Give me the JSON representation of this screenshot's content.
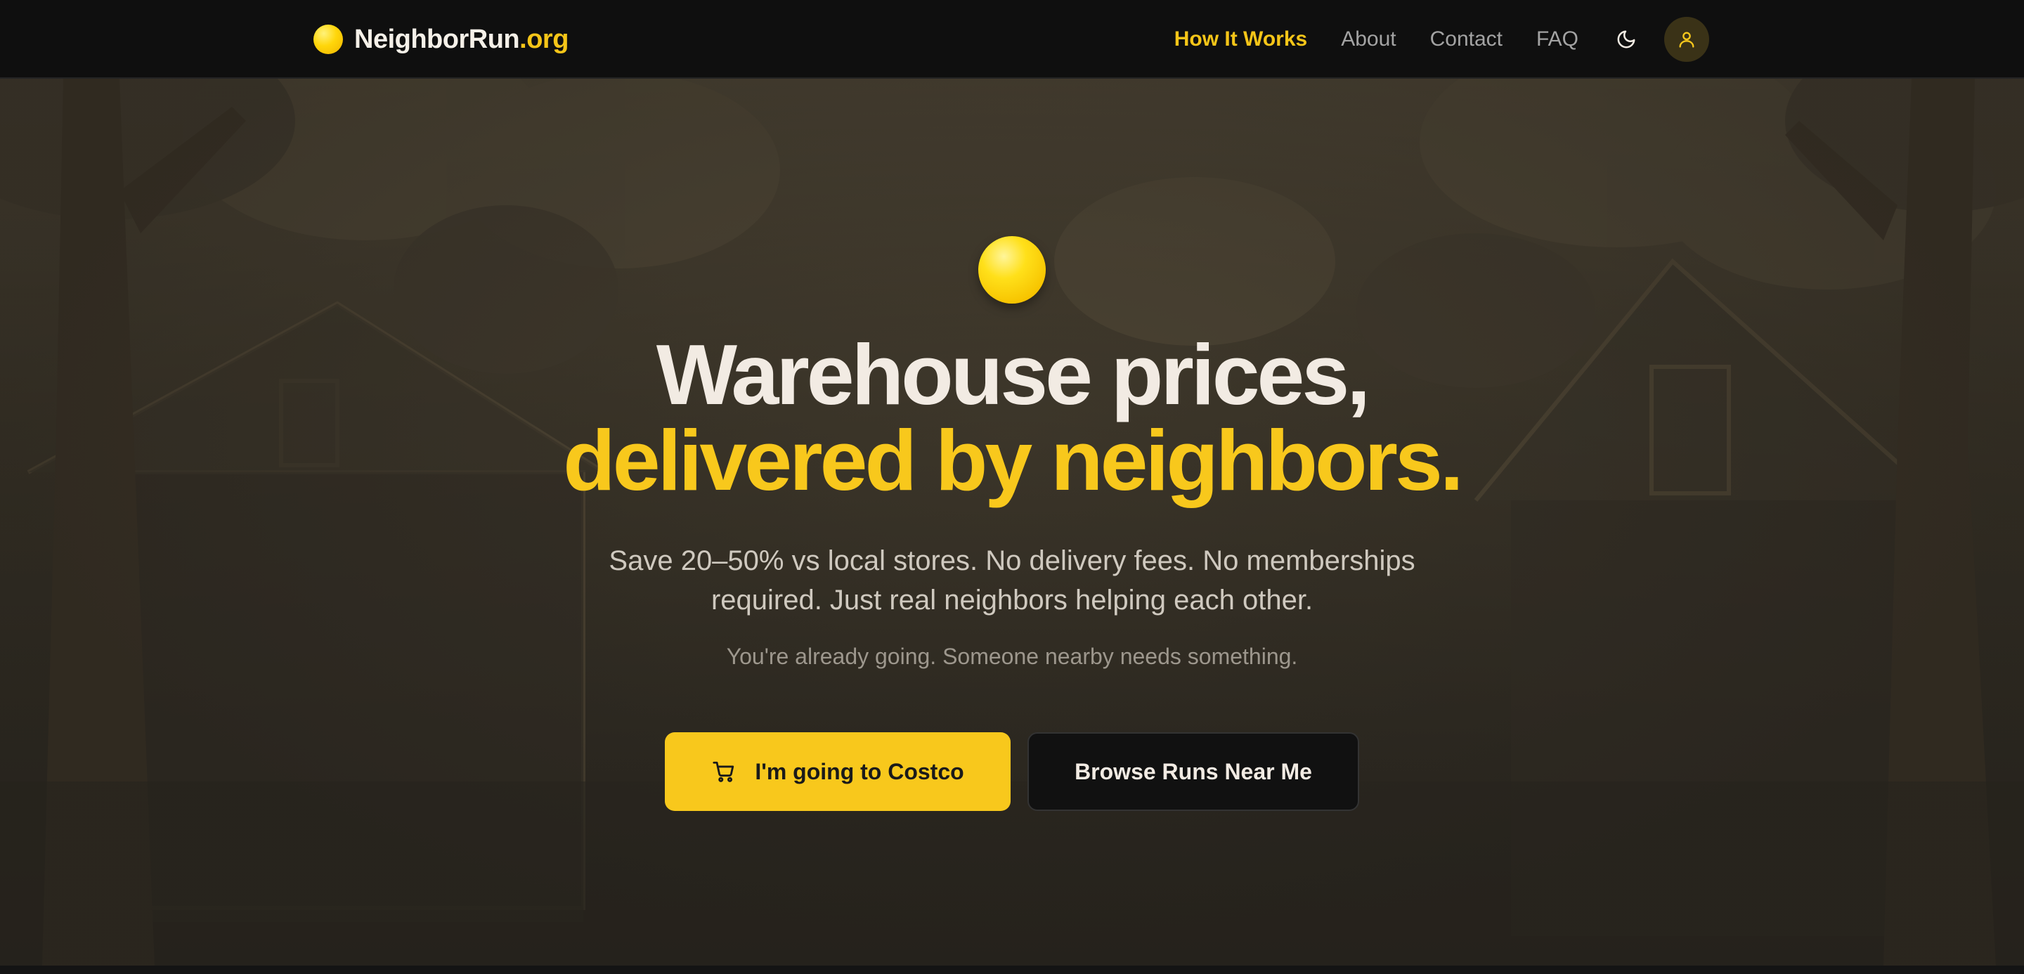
{
  "nav": {
    "brand_name": "NeighborRun",
    "brand_tld": ".org",
    "links": [
      {
        "label": "How It Works",
        "active": true
      },
      {
        "label": "About",
        "active": false
      },
      {
        "label": "Contact",
        "active": false
      },
      {
        "label": "FAQ",
        "active": false
      }
    ],
    "theme_icon": "moon-icon",
    "user_icon": "user-icon"
  },
  "hero": {
    "emoji_icon": "yellow-circle-icon",
    "headline_line1": "Warehouse prices,",
    "headline_line2": "delivered by neighbors.",
    "subhead": "Save 20–50% vs local stores. No delivery fees. No memberships required. Just real neighbors helping each other.",
    "tagline": "You're already going. Someone nearby needs something.",
    "primary_cta": {
      "label": "I'm going to Costco",
      "icon": "shopping-cart-icon"
    },
    "secondary_cta": {
      "label": "Browse Runs Near Me"
    }
  },
  "colors": {
    "accent": "#f8c81c",
    "nav_bg": "#0f0f0f",
    "text_light": "#f2ebe3",
    "text_muted": "#a3a3a3"
  }
}
